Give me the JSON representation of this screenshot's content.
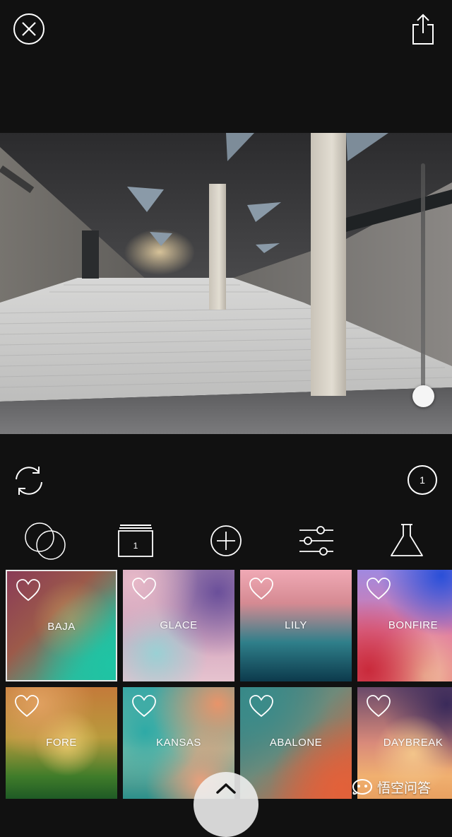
{
  "header": {
    "close_icon": "close-circle-icon",
    "share_icon": "share-icon"
  },
  "photo": {
    "description_icon": "photo-preview"
  },
  "intensity": {
    "level": 0
  },
  "controls": {
    "refresh_icon": "refresh-icon",
    "count_badge": "1"
  },
  "toolbar": {
    "items": [
      {
        "icon": "overlay-circles-icon"
      },
      {
        "icon": "layers-icon",
        "label": "1"
      },
      {
        "icon": "add-circle-icon"
      },
      {
        "icon": "sliders-icon"
      },
      {
        "icon": "flask-icon"
      }
    ]
  },
  "filters": {
    "items": [
      {
        "name": "BAJA",
        "selected": true
      },
      {
        "name": "GLACE",
        "selected": false
      },
      {
        "name": "LILY",
        "selected": false
      },
      {
        "name": "BONFIRE",
        "selected": false
      },
      {
        "name": "FORE",
        "selected": false
      },
      {
        "name": "KANSAS",
        "selected": false
      },
      {
        "name": "ABALONE",
        "selected": false
      },
      {
        "name": "DAYBREAK",
        "selected": false
      }
    ]
  },
  "watermark": {
    "text": "悟空问答"
  }
}
